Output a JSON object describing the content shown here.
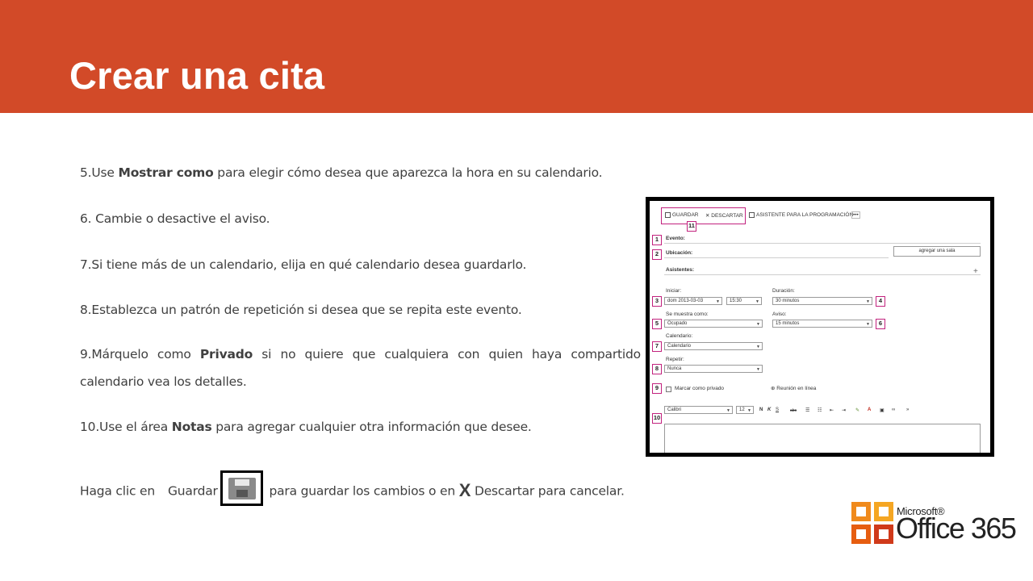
{
  "title": "Crear una cita",
  "steps": {
    "s5": {
      "pre": "5.Use ",
      "bold": "Mostrar como",
      "post": " para elegir cómo desea que aparezca la hora en su calendario."
    },
    "s6": {
      "text": "6. Cambie o desactive el aviso."
    },
    "s7": {
      "text": "7.Si tiene más de un calendario, elija en qué calendario desea guardarlo."
    },
    "s8": {
      "text": "8.Establezca un patrón de repetición si desea que se repita este evento."
    },
    "s9": {
      "pre": "9.Márquelo",
      "w2": "como",
      "bold": "Privado",
      "w4": "si",
      "w5": "no",
      "w6": "quiere",
      "w7": "que",
      "w8": "cualquiera",
      "w9": "con",
      "w10": "quien",
      "w11": "haya",
      "w12": "compartido",
      "line2": "calendario vea los detalles."
    },
    "s10": {
      "pre": "10.Use el área ",
      "bold": "Notas",
      "post": " para agregar cualquier otra información que desee."
    },
    "final": {
      "pre": "Haga clic en",
      "guardar": "Guardar",
      "mid": "para guardar los cambios o en",
      "x": "X",
      "post": "Descartar para cancelar."
    }
  },
  "screenshot": {
    "toolbar": {
      "guardar": "GUARDAR",
      "descartar": "DESCARTAR",
      "asistente": "ASISTENTE PARA LA PROGRAMACIÓN",
      "more": "•••"
    },
    "badges": [
      "1",
      "2",
      "3",
      "4",
      "5",
      "6",
      "7",
      "8",
      "9",
      "10",
      "11"
    ],
    "evento": "Evento:",
    "ubicacion": "Ubicación:",
    "agregar_sala": "agregar una sala",
    "asistentes": "Asistentes:",
    "plus": "+",
    "iniciar": "Iniciar:",
    "fecha": "dom 2013-03-03",
    "hora": "15:30",
    "duracion_label": "Duración:",
    "duracion": "30 minutos",
    "muestra_label": "Se muestra como:",
    "muestra": "Ocupado",
    "aviso_label": "Aviso:",
    "aviso": "15 minutos",
    "calendario_label": "Calendario:",
    "calendario": "Calendario",
    "repetir_label": "Repetir:",
    "repetir": "Nunca",
    "privado": "Marcar como privado",
    "reunion": "Reunión en línea",
    "fuente": "Calibri",
    "tamano": "12",
    "fmt_n": "N",
    "fmt_k": "K",
    "fmt_s": "S",
    "fmt_abc": "abc"
  },
  "logo": {
    "brand": "Microsoft®",
    "product": "Office 365"
  },
  "colors": {
    "banner": "#d24a28",
    "highlight": "#c2227e",
    "logo_orange": "#e65d10",
    "logo_red": "#d03a1a"
  }
}
